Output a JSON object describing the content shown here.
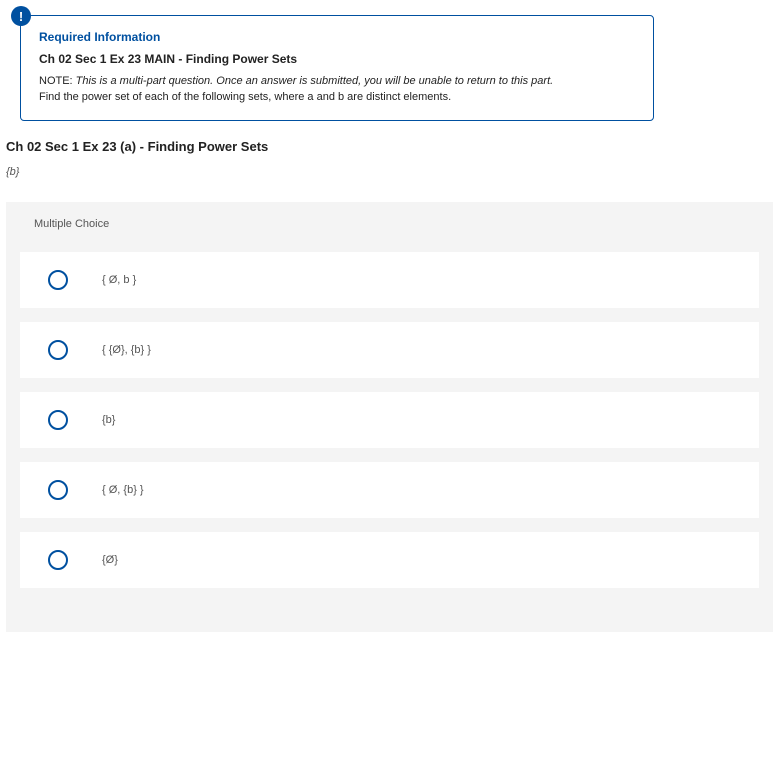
{
  "infoBox": {
    "badge": "!",
    "requiredLabel": "Required Information",
    "title": "Ch 02 Sec 1 Ex 23 MAIN - Finding Power Sets",
    "notePrefix": "NOTE: ",
    "noteItalic": "This is a multi-part question. Once an answer is submitted, you will be unable to return to this part.",
    "noteBody": "Find the power set of each of the following sets, where a and b are distinct elements."
  },
  "question": {
    "title": "Ch 02 Sec 1 Ex 23 (a) - Finding Power Sets",
    "prompt": "{b}"
  },
  "multipleChoice": {
    "header": "Multiple Choice",
    "options": [
      "{ Ø, b }",
      "{ {Ø}, {b} }",
      "{b}",
      "{ Ø, {b} }",
      "{Ø}"
    ]
  }
}
